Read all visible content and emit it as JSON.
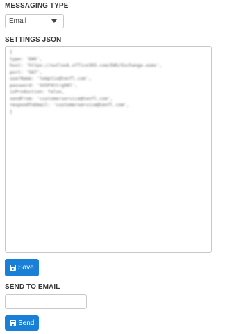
{
  "messaging_type": {
    "label": "MESSAGING TYPE",
    "selected": "Email"
  },
  "settings_json": {
    "label": "SETTINGS JSON",
    "lines": [
      "{",
      "type: 'EWS',",
      "host: 'https://outlook.office365.com/EWS/Exchange.asmx',",
      "port: '587',",
      "userName: 'temptix@tenfl.com',",
      "password: 'SXSP4ttrg98l',",
      "isProduction: false,",
      "sendFrom: 'customerservice@tenfl.com',",
      "respondToEmail: 'customerservice@tenfl.com',",
      "}"
    ]
  },
  "save_button": {
    "label": "Save"
  },
  "send_to_email": {
    "label": "SEND TO EMAIL",
    "value": ""
  },
  "send_button": {
    "label": "Send"
  },
  "colors": {
    "primary_button": "#1a7fd6"
  }
}
